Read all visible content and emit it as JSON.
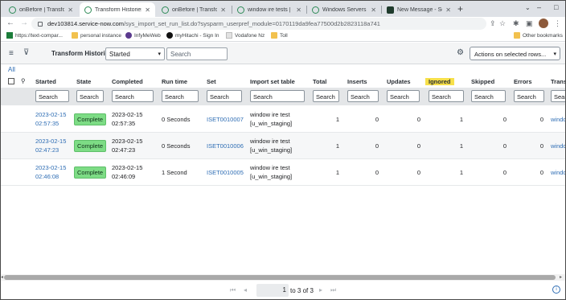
{
  "browser": {
    "tabs": [
      {
        "title": "onBefore | Transform",
        "active": false
      },
      {
        "title": "Transform Histories | S",
        "active": true
      },
      {
        "title": "onBefore | Transform",
        "active": false
      },
      {
        "title": "window ire tests | Ser",
        "active": false
      },
      {
        "title": "Windows Servers | Ser",
        "active": false
      },
      {
        "title": "New Message - Servi",
        "active": false
      }
    ],
    "address_host": "dev103814.service-now.com",
    "address_path": "/sys_import_set_run_list.do?sysparm_userpref_module=0170119da9fea77500d2b2823118a741",
    "bookmarks": [
      {
        "label": "https://text-compar...",
        "icon": "tc-icon"
      },
      {
        "label": "personal instance",
        "icon": "folder-icon"
      },
      {
        "label": "InfyMeWeb",
        "icon": "infy-icon"
      },
      {
        "label": "myHitachi - Sign In",
        "icon": "github-icon"
      },
      {
        "label": "Vodafone Nz",
        "icon": "page-icon"
      },
      {
        "label": "Toll",
        "icon": "folder-icon"
      }
    ],
    "other_bookmarks": "Other bookmarks"
  },
  "list": {
    "title": "Transform Histories",
    "filter_field": "Started",
    "search_placeholder": "Search",
    "actions_label": "Actions on selected rows...",
    "breadcrumb": "All"
  },
  "table": {
    "columns": [
      "Started",
      "State",
      "Completed",
      "Run time",
      "Set",
      "Import set table",
      "Total",
      "Inserts",
      "Updates",
      "Ignored",
      "Skipped",
      "Errors",
      "Transf"
    ],
    "search_label": "Search",
    "rows": [
      {
        "started_date": "2023-02-15",
        "started_time": "02:57:35",
        "state": "Complete",
        "completed_date": "2023-02-15",
        "completed_time": "02:57:35",
        "run_time": "0 Seconds",
        "set": "ISET0010007",
        "table_line1": "window ire test",
        "table_line2": "[u_win_staging]",
        "total": "1",
        "inserts": "0",
        "updates": "0",
        "ignored": "1",
        "skipped": "0",
        "errors": "0",
        "transform": "windo"
      },
      {
        "started_date": "2023-02-15",
        "started_time": "02:47:23",
        "state": "Complete",
        "completed_date": "2023-02-15",
        "completed_time": "02:47:23",
        "run_time": "0 Seconds",
        "set": "ISET0010006",
        "table_line1": "window ire test",
        "table_line2": "[u_win_staging]",
        "total": "1",
        "inserts": "0",
        "updates": "0",
        "ignored": "1",
        "skipped": "0",
        "errors": "0",
        "transform": "windo"
      },
      {
        "started_date": "2023-02-15",
        "started_time": "02:46:08",
        "state": "Complete",
        "completed_date": "2023-02-15",
        "completed_time": "02:46:09",
        "run_time": "1 Second",
        "set": "ISET0010005",
        "table_line1": "window ire test",
        "table_line2": "[u_win_staging]",
        "total": "1",
        "inserts": "0",
        "updates": "0",
        "ignored": "1",
        "skipped": "0",
        "errors": "0",
        "transform": "windo"
      }
    ]
  },
  "pagination": {
    "current": "1",
    "summary": "to 3 of 3"
  },
  "colors": {
    "link": "#2e6db4",
    "complete_pill": "#7ddc85",
    "highlight": "#f7e04a"
  }
}
